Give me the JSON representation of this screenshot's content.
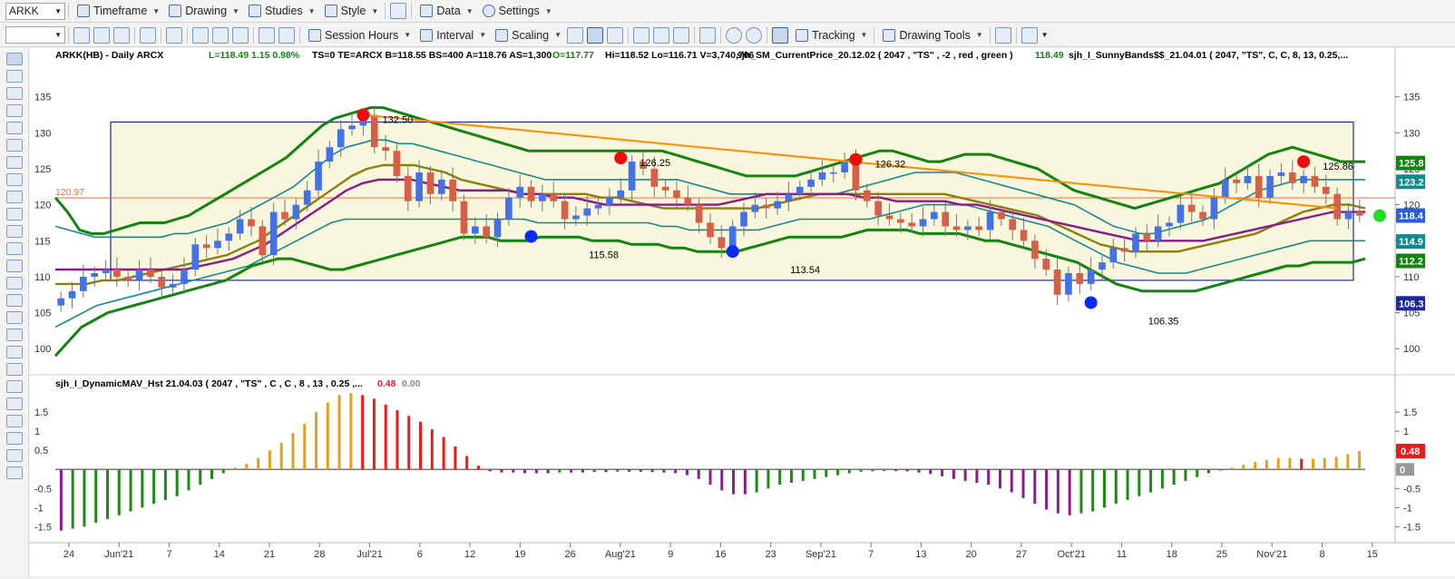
{
  "toolbar_top": {
    "symbol": "ARKK",
    "buttons": [
      {
        "name": "timeframe-button",
        "label": "Timeframe"
      },
      {
        "name": "drawing-button",
        "label": "Drawing"
      },
      {
        "name": "studies-button",
        "label": "Studies"
      },
      {
        "name": "style-button",
        "label": "Style"
      },
      {
        "name": "data-button",
        "label": "Data"
      },
      {
        "name": "settings-button",
        "label": "Settings"
      }
    ]
  },
  "toolbar_second": {
    "session_hours": "Session Hours",
    "interval": "Interval",
    "scaling": "Scaling",
    "tracking": "Tracking",
    "drawing_tools": "Drawing Tools"
  },
  "header": {
    "symbol_text": "ARKK(HB) - Daily  ARCX",
    "quote_text": "L=118.49  1.15  0.98%",
    "details_text": "TS=0  TE=ARCX  B=118.55  BS=400  A=118.76  AS=1,300",
    "open_text": "O=117.77",
    "range_text": "Hi=118.52  Lo=116.71  V=3,740,706",
    "study1": "sjh_SM_CurrentPrice_20.12.02 ( 2047 , \"TS\" , -2 , red , green )",
    "study1_value": "118.49",
    "study2": "sjh_I_SunnyBands$$_21.04.01 (  2047,  \"TS\",  C,  C,    8,  13,  0.25,..."
  },
  "lower_header": {
    "study": "sjh_I_DynamicMAV_Hst 21.04.03 ( 2047 , \"TS\" , C , C ,  8 , 13 , 0.25 ,...",
    "value1": "0.48",
    "value2": "0.00"
  },
  "colors": {
    "up": "#4472e6",
    "down": "#d65f48",
    "outer_band": "#12840f",
    "inner_band": "#138a8c",
    "mid_band": "#8c7f0c",
    "ema": "#8a1a8a",
    "trend": "#ff8c00",
    "box_fill": "#f8f6dc",
    "box_border": "#1e2a9c",
    "hist_green": "#1d8a13",
    "hist_gold": "#e0a21c",
    "hist_red": "#ea1b1b",
    "hist_purple": "#8b1c8b"
  },
  "chart_data": [
    {
      "type": "candlestick",
      "y_ticks": [
        100,
        105,
        110,
        115,
        120,
        125,
        130,
        135
      ],
      "ylim": [
        97,
        139
      ],
      "x_labels": [
        "24",
        "Jun'21",
        "7",
        "14",
        "21",
        "28",
        "Jul'21",
        "6",
        "12",
        "19",
        "26",
        "Aug'21",
        "9",
        "16",
        "23",
        "Sep'21",
        "7",
        "13",
        "20",
        "27",
        "Oct'21",
        "11",
        "18",
        "25",
        "Nov'21",
        "8",
        "15"
      ],
      "close": [
        107,
        108,
        110,
        110.5,
        111,
        110,
        109.5,
        111,
        110,
        108.5,
        109,
        111,
        114.5,
        114,
        115,
        116,
        118,
        117,
        113,
        119,
        118,
        120,
        122,
        126,
        128,
        130.5,
        131,
        132.5,
        128,
        127.5,
        124,
        120.5,
        124.5,
        121.5,
        123.5,
        120.5,
        116,
        117,
        115.5,
        118,
        121,
        122.5,
        120.5,
        121.5,
        120.5,
        118,
        118.5,
        119.5,
        120,
        121,
        122,
        126,
        125,
        122.5,
        122,
        121,
        120,
        117.5,
        115.5,
        114,
        117,
        119,
        120,
        119.5,
        120.5,
        121.5,
        122.5,
        123.5,
        124.5,
        124.5,
        126,
        122,
        120.5,
        118.5,
        118,
        117.5,
        117,
        118,
        119,
        117,
        116.5,
        117,
        116.5,
        119,
        118,
        116.5,
        115,
        112.5,
        111,
        107.5,
        110.5,
        109,
        111,
        112,
        114,
        113.5,
        116,
        115,
        117,
        117.5,
        120,
        119,
        118,
        121,
        123.5,
        123,
        124,
        121,
        124,
        124.5,
        123,
        124,
        122.5,
        121.5,
        118,
        119,
        118.49
      ],
      "bands": {
        "upper_outer": [
          121,
          119,
          116.5,
          116,
          116,
          116.5,
          117,
          117.5,
          117.5,
          117.5,
          118,
          118.5,
          119.5,
          120.5,
          121.5,
          122.5,
          123.5,
          124.5,
          125.5,
          126.5,
          128,
          129.5,
          131,
          132,
          132.5,
          133,
          133.5,
          133.5,
          133,
          132.5,
          132,
          131.5,
          131,
          130.5,
          130,
          129.5,
          129,
          128.5,
          128,
          127.5,
          127.5,
          127.5,
          127.5,
          127.5,
          127.5,
          127.5,
          127.5,
          127.5,
          127.5,
          127.5,
          127.5,
          127,
          126.5,
          126,
          125.5,
          125,
          124.5,
          124,
          124,
          124,
          124,
          124,
          124.5,
          125,
          125.5,
          126,
          126.5,
          127,
          127.5,
          127.5,
          127,
          126.5,
          126,
          126,
          126.5,
          127,
          127,
          127,
          126.5,
          126,
          125.5,
          125,
          124,
          123,
          122,
          121.5,
          121,
          120.5,
          120,
          119.5,
          120,
          120.5,
          121,
          121.5,
          122,
          122.5,
          123,
          124,
          125,
          126,
          127,
          127.5,
          128,
          127.5,
          127,
          126.5,
          126,
          126,
          126
        ],
        "lower_outer": [
          99,
          101,
          103,
          104,
          105,
          105.5,
          106,
          106.5,
          107,
          107.5,
          108,
          108.5,
          109,
          109.5,
          110.5,
          111.5,
          112,
          112.5,
          112.5,
          112,
          111.5,
          111,
          111,
          111.5,
          112,
          112.5,
          113,
          113.5,
          114,
          114.5,
          115,
          115.5,
          115.5,
          115.5,
          115,
          115,
          115,
          115.5,
          115.5,
          115.5,
          115.5,
          115,
          115,
          115,
          114.5,
          114.5,
          114.5,
          114,
          114,
          113.5,
          113.5,
          113.5,
          113.5,
          114,
          114.5,
          115,
          115.5,
          115.5,
          115.5,
          115.5,
          115.5,
          116,
          116.5,
          116.5,
          116.5,
          116.5,
          116,
          116,
          116,
          116,
          115.5,
          115,
          115,
          114.5,
          114,
          113.5,
          113,
          112.5,
          112,
          111,
          110,
          109,
          108.5,
          108,
          108,
          108,
          108,
          108,
          108.5,
          109,
          109.5,
          110,
          110.5,
          111,
          111.5,
          111.5,
          112,
          112,
          112,
          112,
          112.5
        ],
        "upper_inner": [
          117,
          116.5,
          116,
          115.5,
          115.5,
          115.5,
          115.5,
          115.5,
          115.5,
          116,
          116,
          116.5,
          117,
          117.5,
          118.5,
          119.5,
          120.5,
          121.5,
          122.5,
          124,
          125.5,
          127,
          128,
          128.5,
          129,
          129,
          128.5,
          128.5,
          128,
          127.5,
          127,
          126.5,
          126,
          125.5,
          125,
          124.5,
          124,
          123.5,
          123.5,
          123.5,
          123.5,
          123.5,
          123.5,
          123.5,
          123.5,
          123.5,
          123.5,
          123.5,
          123,
          122.5,
          122,
          121.5,
          121.5,
          121.5,
          121.5,
          121.5,
          121.5,
          121.5,
          121.5,
          121.5,
          122,
          122.5,
          123,
          123.5,
          124,
          124.5,
          124.5,
          124.5,
          124.5,
          124,
          123.5,
          123,
          122.5,
          122,
          121.5,
          121,
          120.5,
          120,
          119,
          118,
          117,
          116.5,
          116,
          116,
          116.5,
          117,
          117.5,
          118,
          119,
          120,
          121,
          122,
          122.5,
          123,
          123.5,
          123.5,
          123.5,
          123.5,
          123.5,
          123.5
        ],
        "lower_inner": [
          103,
          104,
          105,
          106,
          106.5,
          107,
          107.5,
          108,
          108.5,
          109,
          109.5,
          110,
          110.5,
          111,
          111.5,
          112.5,
          113.5,
          114.5,
          115.5,
          116.5,
          117.5,
          118,
          118,
          118,
          118,
          118,
          118,
          118,
          118,
          118,
          118,
          118,
          118,
          118,
          118,
          117.5,
          117.5,
          117.5,
          117.5,
          117.5,
          117.5,
          117.5,
          117.5,
          117.5,
          117,
          117,
          116.5,
          116.5,
          116.5,
          116.5,
          116.5,
          116.5,
          117,
          117.5,
          118,
          118,
          118,
          118,
          118,
          118,
          118.5,
          119,
          119.5,
          120,
          120,
          120,
          120,
          119.5,
          119,
          118.5,
          118,
          117.5,
          117,
          116,
          115,
          114,
          113,
          112,
          111.5,
          111,
          110.5,
          110.5,
          110.5,
          111,
          111.5,
          112,
          112.5,
          113,
          113.5,
          114,
          114.5,
          115,
          115,
          115,
          115,
          115
        ],
        "mid": [
          109,
          109,
          109,
          109.5,
          109.5,
          110,
          110.5,
          111,
          111.5,
          112,
          112.5,
          113,
          114,
          115,
          116.5,
          118,
          119.5,
          121,
          122.5,
          124,
          125,
          125.5,
          125.5,
          125.5,
          125,
          124.5,
          123.5,
          123,
          122.5,
          122,
          121.5,
          121.5,
          121.5,
          121.5,
          121.5,
          121,
          121,
          120.5,
          120,
          119.5,
          119.5,
          119.5,
          119.5,
          119.5,
          119.5,
          119.5,
          120,
          120.5,
          121,
          121.5,
          121.5,
          121.5,
          121.5,
          121.5,
          121.5,
          121.5,
          121.5,
          121.5,
          121,
          120.5,
          120,
          119.5,
          119,
          118.5,
          117.5,
          116.5,
          115.5,
          114.5,
          114,
          113.5,
          113.5,
          113.5,
          113.5,
          114,
          114.5,
          115,
          115.5,
          116,
          117,
          118,
          119,
          119.5,
          120,
          120,
          119.5
        ],
        "ema": [
          111,
          111,
          111,
          111,
          111,
          111,
          111,
          111,
          111,
          111.5,
          112,
          112.5,
          113.5,
          114.5,
          116,
          117.5,
          119,
          120.5,
          122,
          123,
          123.5,
          123.5,
          123.5,
          123,
          122.5,
          122,
          122,
          122,
          122,
          121.5,
          121.5,
          121,
          121,
          120.5,
          120,
          120,
          120,
          120,
          120,
          120,
          120,
          120,
          120.5,
          121,
          121.5,
          121.5,
          121.5,
          121.5,
          121.5,
          121.5,
          121,
          121,
          120.5,
          120.5,
          120.5,
          120.5,
          120,
          120,
          119.5,
          119,
          118.5,
          118,
          117.5,
          117,
          116.5,
          116,
          115.5,
          115,
          115,
          115,
          115,
          115,
          115.5,
          116,
          116.5,
          117,
          117.5,
          118,
          118.5,
          119,
          119,
          119
        ]
      },
      "annotations": [
        {
          "text": "132.50",
          "x_index": 27,
          "y": 132.5,
          "marker": "red"
        },
        {
          "text": "126.25",
          "x_index": 50,
          "y": 126.5,
          "marker": "red"
        },
        {
          "text": "126.32",
          "x_index": 71,
          "y": 126.3,
          "marker": "red"
        },
        {
          "text": "125.86",
          "x_index": 111,
          "y": 126,
          "marker": "red"
        },
        {
          "text": "115.58",
          "x_index": 42,
          "y": 115.6,
          "marker": "blue"
        },
        {
          "text": "113.54",
          "x_index": 60,
          "y": 113.5,
          "marker": "blue"
        },
        {
          "text": "106.35",
          "x_index": 92,
          "y": 106.4,
          "marker": "blue"
        }
      ],
      "hline": {
        "value": 120.97,
        "label": "120.97"
      },
      "trendline": {
        "from": [
          27,
          132.5
        ],
        "to": [
          114,
          119.5
        ]
      },
      "right_labels": [
        {
          "text": "125.8",
          "y": 125.8,
          "color": "#12840f"
        },
        {
          "text": "123.2",
          "y": 123.2,
          "color": "#138a8c"
        },
        {
          "text": "118.4",
          "y": 118.5,
          "color": "#2a5fd9"
        },
        {
          "text": "114.9",
          "y": 114.9,
          "color": "#138a8c"
        },
        {
          "text": "112.2",
          "y": 112.2,
          "color": "#12840f"
        },
        {
          "text": "106.3",
          "y": 106.3,
          "color": "#1e2a9c"
        }
      ]
    },
    {
      "type": "histogram",
      "y_ticks": [
        1.5,
        1,
        0.5,
        0,
        -0.5,
        -1,
        -1.5
      ],
      "ylim": [
        -1.8,
        2.05
      ],
      "values": [
        -1.6,
        -1.55,
        -1.5,
        -1.4,
        -1.3,
        -1.2,
        -1.1,
        -1.0,
        -0.9,
        -0.8,
        -0.7,
        -0.55,
        -0.4,
        -0.25,
        -0.1,
        0.05,
        0.15,
        0.3,
        0.5,
        0.7,
        0.95,
        1.2,
        1.5,
        1.75,
        1.95,
        2.0,
        1.95,
        1.85,
        1.7,
        1.55,
        1.4,
        1.25,
        1.05,
        0.85,
        0.6,
        0.35,
        0.1,
        -0.05,
        -0.08,
        -0.08,
        -0.1,
        -0.1,
        -0.1,
        -0.08,
        -0.08,
        -0.08,
        -0.07,
        -0.07,
        -0.06,
        -0.06,
        -0.06,
        -0.07,
        -0.08,
        -0.1,
        -0.15,
        -0.25,
        -0.4,
        -0.55,
        -0.65,
        -0.65,
        -0.6,
        -0.5,
        -0.4,
        -0.35,
        -0.3,
        -0.25,
        -0.2,
        -0.15,
        -0.1,
        -0.06,
        -0.05,
        -0.04,
        -0.04,
        -0.05,
        -0.08,
        -0.12,
        -0.18,
        -0.25,
        -0.3,
        -0.35,
        -0.4,
        -0.5,
        -0.6,
        -0.75,
        -0.9,
        -1.05,
        -1.15,
        -1.2,
        -1.15,
        -1.1,
        -1.0,
        -0.9,
        -0.8,
        -0.7,
        -0.6,
        -0.5,
        -0.4,
        -0.3,
        -0.2,
        -0.1,
        -0.03,
        0.05,
        0.12,
        0.2,
        0.25,
        0.3,
        0.3,
        0.28,
        0.28,
        0.3,
        0.33,
        0.4,
        0.48
      ]
    }
  ]
}
